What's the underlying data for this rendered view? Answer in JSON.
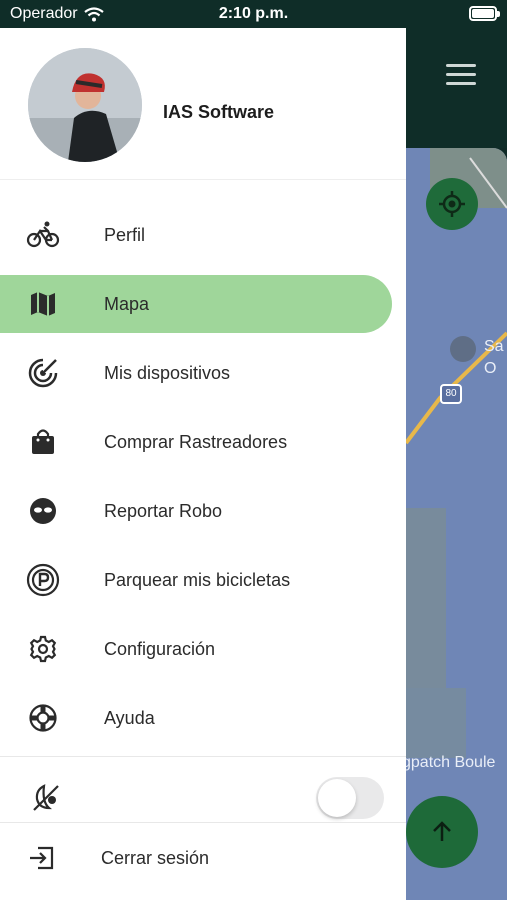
{
  "status_bar": {
    "carrier": "Operador",
    "time": "2:10 p.m.",
    "battery_level": 1.0
  },
  "profile": {
    "name": "IAS Software"
  },
  "menu": {
    "items": [
      {
        "label": "Perfil",
        "icon": "bicycle-icon",
        "active": false
      },
      {
        "label": "Mapa",
        "icon": "map-icon",
        "active": true
      },
      {
        "label": "Mis dispositivos",
        "icon": "radar-icon",
        "active": false
      },
      {
        "label": "Comprar Rastreadores",
        "icon": "shopping-bag-icon",
        "active": false
      },
      {
        "label": "Reportar Robo",
        "icon": "mask-icon",
        "active": false
      },
      {
        "label": "Parquear mis bicicletas",
        "icon": "parking-icon",
        "active": false
      },
      {
        "label": "Configuración",
        "icon": "gear-icon",
        "active": false
      },
      {
        "label": "Ayuda",
        "icon": "lifebuoy-icon",
        "active": false
      }
    ]
  },
  "theme_toggle": {
    "icon": "dark-mode-icon",
    "enabled": false
  },
  "logout": {
    "label": "Cerrar sesión",
    "icon": "logout-icon"
  },
  "map": {
    "place_label": "gpatch Boule",
    "route_label": "80",
    "poi_label_1": "Sa",
    "poi_label_2": "O"
  },
  "colors": {
    "accent": "#9fd69a",
    "header": "#0f2d28",
    "fab": "#1e6a39"
  }
}
